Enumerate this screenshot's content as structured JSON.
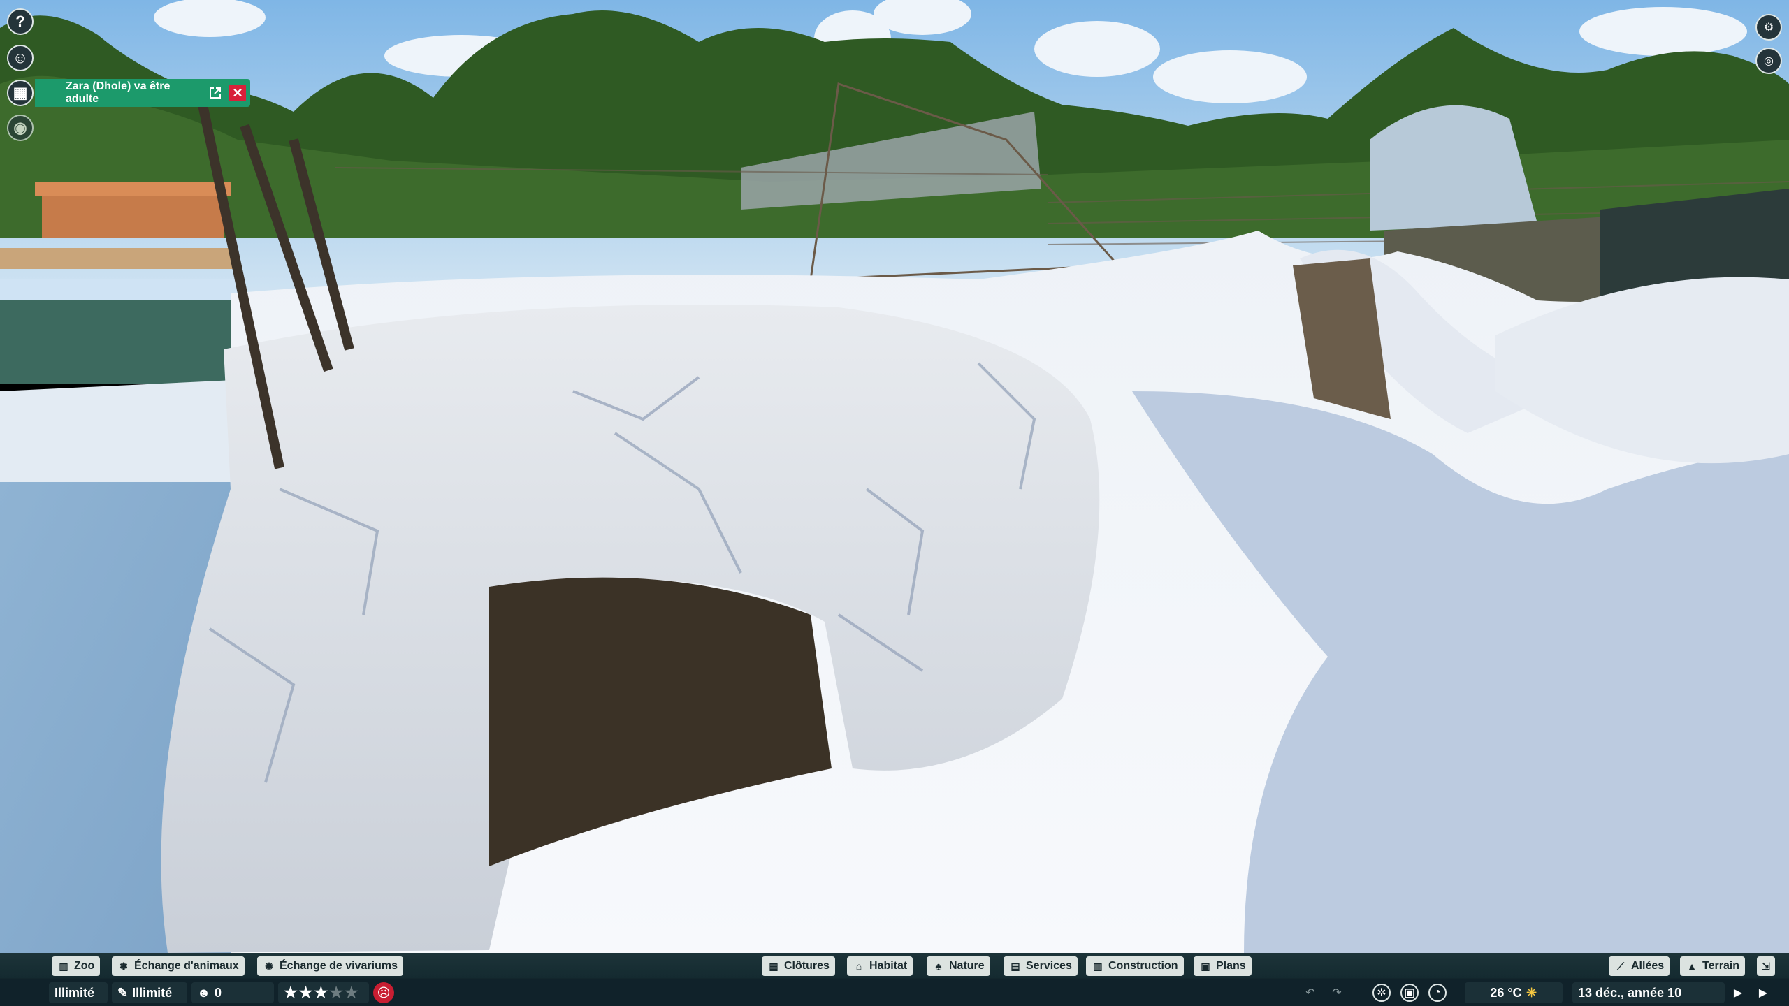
{
  "notification": {
    "text": "Zara (Dhole) va être adulte"
  },
  "left_rail": {
    "items": [
      {
        "icon": "help-icon",
        "glyph": "?"
      },
      {
        "icon": "zookeeper-icon",
        "glyph": "☺"
      },
      {
        "icon": "calendar-icon",
        "glyph": "▦"
      },
      {
        "icon": "visibility-icon",
        "glyph": "◉"
      }
    ]
  },
  "right_rail": {
    "items": [
      {
        "icon": "settings-icon",
        "glyph": "⚙"
      },
      {
        "icon": "camera-mode-icon",
        "glyph": "◎"
      }
    ]
  },
  "toolbar": {
    "left": [
      {
        "label": "Zoo",
        "icon": "zoo-icon",
        "glyph": "▥"
      },
      {
        "label": "Échange d'animaux",
        "icon": "paw-icon",
        "glyph": "✽"
      },
      {
        "label": "Échange de vivariums",
        "icon": "vivarium-icon",
        "glyph": "✺"
      }
    ],
    "center": [
      {
        "label": "Clôtures",
        "icon": "fence-icon",
        "glyph": "▦"
      },
      {
        "label": "Habitat",
        "icon": "habitat-icon",
        "glyph": "⌂"
      },
      {
        "label": "Nature",
        "icon": "tree-icon",
        "glyph": "♣"
      },
      {
        "label": "Services",
        "icon": "shop-icon",
        "glyph": "▤"
      },
      {
        "label": "Construction",
        "icon": "construction-icon",
        "glyph": "▥"
      },
      {
        "label": "Plans",
        "icon": "blueprint-icon",
        "glyph": "▣"
      }
    ],
    "right": [
      {
        "label": "Allées",
        "icon": "path-icon",
        "glyph": "⟋"
      },
      {
        "label": "Terrain",
        "icon": "terrain-icon",
        "glyph": "▲"
      }
    ]
  },
  "status": {
    "money": "Illimité",
    "research": "Illimité",
    "guests": "0",
    "rating": 3,
    "rating_max": 5,
    "temperature": "26 °C",
    "date": "13 déc., année 10"
  }
}
